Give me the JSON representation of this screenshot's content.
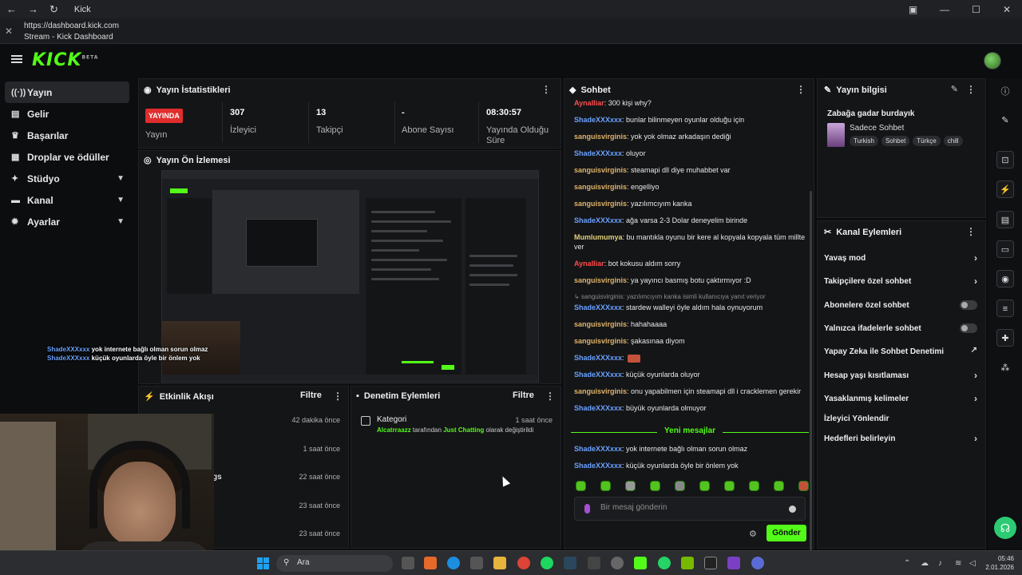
{
  "window": {
    "title": "Kick",
    "url": "https://dashboard.kick.com",
    "page_title": "Stream - Kick Dashboard"
  },
  "brand": {
    "logo": "KICK",
    "logo_sup": "BETA",
    "accent": "#53fc18"
  },
  "sidebar": {
    "items": [
      {
        "label": "Yayın",
        "icon": "broadcast-icon",
        "active": true
      },
      {
        "label": "Gelir",
        "icon": "revenue-icon"
      },
      {
        "label": "Başarılar",
        "icon": "trophy-icon"
      },
      {
        "label": "Droplar ve ödüller",
        "icon": "gift-icon"
      },
      {
        "label": "Stüdyo",
        "icon": "studio-icon",
        "expandable": true
      },
      {
        "label": "Kanal",
        "icon": "channel-icon",
        "expandable": true
      },
      {
        "label": "Ayarlar",
        "icon": "gear-icon",
        "expandable": true
      }
    ]
  },
  "stats": {
    "title": "Yayın İstatistikleri",
    "live_badge": "YAYINDA",
    "items": [
      {
        "label": "Yayın"
      },
      {
        "value": "307",
        "label": "İzleyici"
      },
      {
        "value": "13",
        "label": "Takipçi"
      },
      {
        "value": "-",
        "label": "Abone Sayısı"
      },
      {
        "value": "08:30:57",
        "label": "Yayında Olduğu Süre"
      }
    ]
  },
  "preview": {
    "title": "Yayın Ön İzlemesi"
  },
  "activity": {
    "title": "Etkinlik Akışı",
    "filter": "Filtre",
    "rows": [
      {
        "text": "",
        "time": "42 dakika önce"
      },
      {
        "text": "",
        "time": "1 saat önce"
      },
      {
        "text": "gs",
        "time": "22 saat önce"
      },
      {
        "text": "",
        "time": "23 saat önce"
      },
      {
        "text": "",
        "time": "23 saat önce"
      }
    ]
  },
  "moderation": {
    "title": "Denetim Eylemleri",
    "filter": "Filtre",
    "item": {
      "title": "Kategori",
      "user": "Alcatrraazz",
      "mid": "tarafından",
      "category": "Just Chatting",
      "end": "olarak değiştirildi",
      "time": "1 saat önce"
    }
  },
  "webcam_overlay": [
    {
      "user": "ShadeXXXxxx",
      "text": "yok internete bağlı olman sorun olmaz"
    },
    {
      "user": "ShadeXXXxxx",
      "text": "küçük oyunlarda öyle bir önlem yok"
    }
  ],
  "chat": {
    "title": "Sohbet",
    "messages": [
      {
        "user": "AynaIIiar",
        "color": "#ff4d4d",
        "text": ": 300 kişi why?"
      },
      {
        "user": "ShadeXXXxxx",
        "color": "#6aa1ff",
        "text": ": bunlar bilinmeyen oyunlar olduğu için"
      },
      {
        "user": "sanguisvirginis",
        "color": "#e0b36a",
        "text": ": yok yok olmaz arkadaşın dediği"
      },
      {
        "user": "ShadeXXXxxx",
        "color": "#6aa1ff",
        "text": ": oluyor"
      },
      {
        "user": "sanguisvirginis",
        "color": "#e0b36a",
        "text": ": steamapi dll diye muhabbet var"
      },
      {
        "user": "sanguisvirginis",
        "color": "#e0b36a",
        "text": ": engelliyo"
      },
      {
        "user": "sanguisvirginis",
        "color": "#e0b36a",
        "text": ": yazılımcıyım kanka"
      },
      {
        "user": "ShadeXXXxxx",
        "color": "#6aa1ff",
        "text": ": ağa varsa 2-3 Dolar deneyelim birinde"
      },
      {
        "user": "Mumlumumya",
        "color": "#e0d07a",
        "text": ": bu mantıkla oyunu bir kere al kopyala kopyala tüm millte ver"
      },
      {
        "user": "AynaIIiar",
        "color": "#ff4d4d",
        "text": ": bot kokusu aldım sorry"
      },
      {
        "user": "sanguisvirginis",
        "color": "#e0b36a",
        "text": ": ya yayıncı basmış botu çaktırmıyor :D"
      },
      {
        "reply": "↳ sanguisvirginis: yazılımcıyım kanka isimli kullanıcıya yanıt veriyor",
        "user": "ShadeXXXxxx",
        "color": "#6aa1ff",
        "text": ": stardew walleyi öyle aldım hala oynuyorum"
      },
      {
        "user": "sanguisvirginis",
        "color": "#e0b36a",
        "text": ": hahahaaaa"
      },
      {
        "user": "sanguisvirginis",
        "color": "#e0b36a",
        "text": ": şakasınaa diyom"
      },
      {
        "user": "ShadeXXXxxx",
        "color": "#6aa1ff",
        "text": ":"
      },
      {
        "user": "ShadeXXXxxx",
        "color": "#6aa1ff",
        "text": ": küçük oyunlarda oluyor"
      },
      {
        "user": "sanguisvirginis",
        "color": "#e0b36a",
        "text": ": onu yapabilmen için steamapi dll i cracklemen gerekir"
      },
      {
        "user": "ShadeXXXxxx",
        "color": "#6aa1ff",
        "text": ": büyük oyunlarda olmuyor"
      }
    ],
    "new_messages_label": "Yeni mesajlar",
    "new_messages": [
      {
        "user": "ShadeXXXxxx",
        "color": "#6aa1ff",
        "text": ": yok internete bağlı olman sorun olmaz"
      },
      {
        "user": "ShadeXXXxxx",
        "color": "#6aa1ff",
        "text": ": küçük oyunlarda öyle bir önlem yok"
      }
    ],
    "input_placeholder": "Bir mesaj gönderin",
    "send_label": "Gönder"
  },
  "stream_info": {
    "title": "Yayın bilgisi",
    "stream_title": "Zabağa gadar burdayık",
    "category": "Sadece Sohbet",
    "tags": [
      "Turkish",
      "Sohbet",
      "Türkçe",
      "chill"
    ]
  },
  "channel_actions": {
    "title": "Kanal Eylemleri",
    "items": [
      {
        "label": "Yavaş mod",
        "control": "chevron"
      },
      {
        "label": "Takipçilere özel sohbet",
        "control": "chevron"
      },
      {
        "label": "Abonelere özel sohbet",
        "control": "toggle"
      },
      {
        "label": "Yalnızca ifadelerle sohbet",
        "control": "toggle"
      },
      {
        "label": "Yapay Zeka ile Sohbet Denetimi",
        "control": "external"
      },
      {
        "label": "Hesap yaşı kısıtlaması",
        "control": "chevron"
      },
      {
        "label": "Yasaklanmış kelimeler",
        "control": "chevron"
      },
      {
        "label": "İzleyici Yönlendir",
        "control": "none"
      },
      {
        "label": "Hedefleri belirleyin",
        "control": "chevron"
      }
    ]
  },
  "taskbar": {
    "search_placeholder": "Ara",
    "time": "05:46",
    "date": "2.01.2026"
  }
}
